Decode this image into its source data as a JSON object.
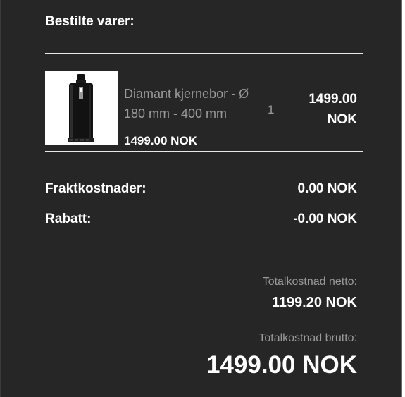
{
  "order": {
    "heading": "Bestilte varer:",
    "item": {
      "name": "Diamant kjernebor - Ø 180 mm - 400 mm",
      "quantity": "1",
      "unit_price": "1499.00 NOK",
      "total_line1": "1499.00",
      "total_line2": "NOK",
      "image": "diamond-core-drill-bit"
    },
    "shipping": {
      "label": "Fraktkostnader:",
      "value": "0.00 NOK"
    },
    "discount": {
      "label": "Rabatt:",
      "value": "-0.00 NOK"
    },
    "net": {
      "label": "Totalkostnad netto:",
      "value": "1199.20 NOK"
    },
    "gross": {
      "label": "Totalkostnad brutto:",
      "value": "1499.00 NOK"
    }
  },
  "colors": {
    "background": "#262626",
    "text": "#ffffff",
    "muted_text": "#9a9a9a",
    "divider": "#e8e8e8"
  }
}
